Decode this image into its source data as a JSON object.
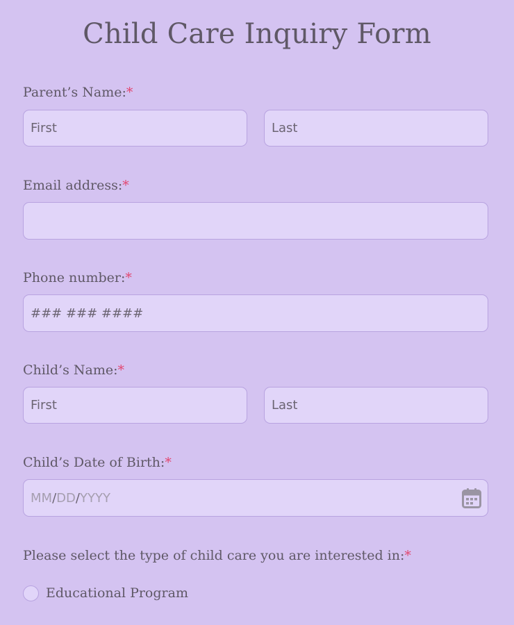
{
  "form": {
    "title": "Child Care Inquiry Form"
  },
  "parent_name": {
    "label": "Parent’s Name:",
    "required": "*",
    "first_placeholder": "First",
    "last_placeholder": "Last"
  },
  "email": {
    "label": "Email address:",
    "required": "*",
    "value": ""
  },
  "phone": {
    "label": "Phone number:",
    "required": "*",
    "placeholder": "### ### ####"
  },
  "child_name": {
    "label": "Child’s Name:",
    "required": "*",
    "first_placeholder": "First",
    "last_placeholder": "Last"
  },
  "dob": {
    "label": "Child’s Date of Birth:",
    "required": "*",
    "mm": "MM",
    "dd": "DD",
    "yyyy": "YYYY",
    "separator": "/",
    "icon": "calendar-icon"
  },
  "care_type": {
    "question": "Please select the type of child care you are interested in:",
    "required": "*",
    "options": [
      {
        "label": "Educational Program",
        "selected": false
      }
    ]
  },
  "colors": {
    "background": "#d4c3f1",
    "field_bg": "#e1d5f9",
    "field_border": "#b8a3e0",
    "text": "#5f5866",
    "required": "#e2466f"
  }
}
